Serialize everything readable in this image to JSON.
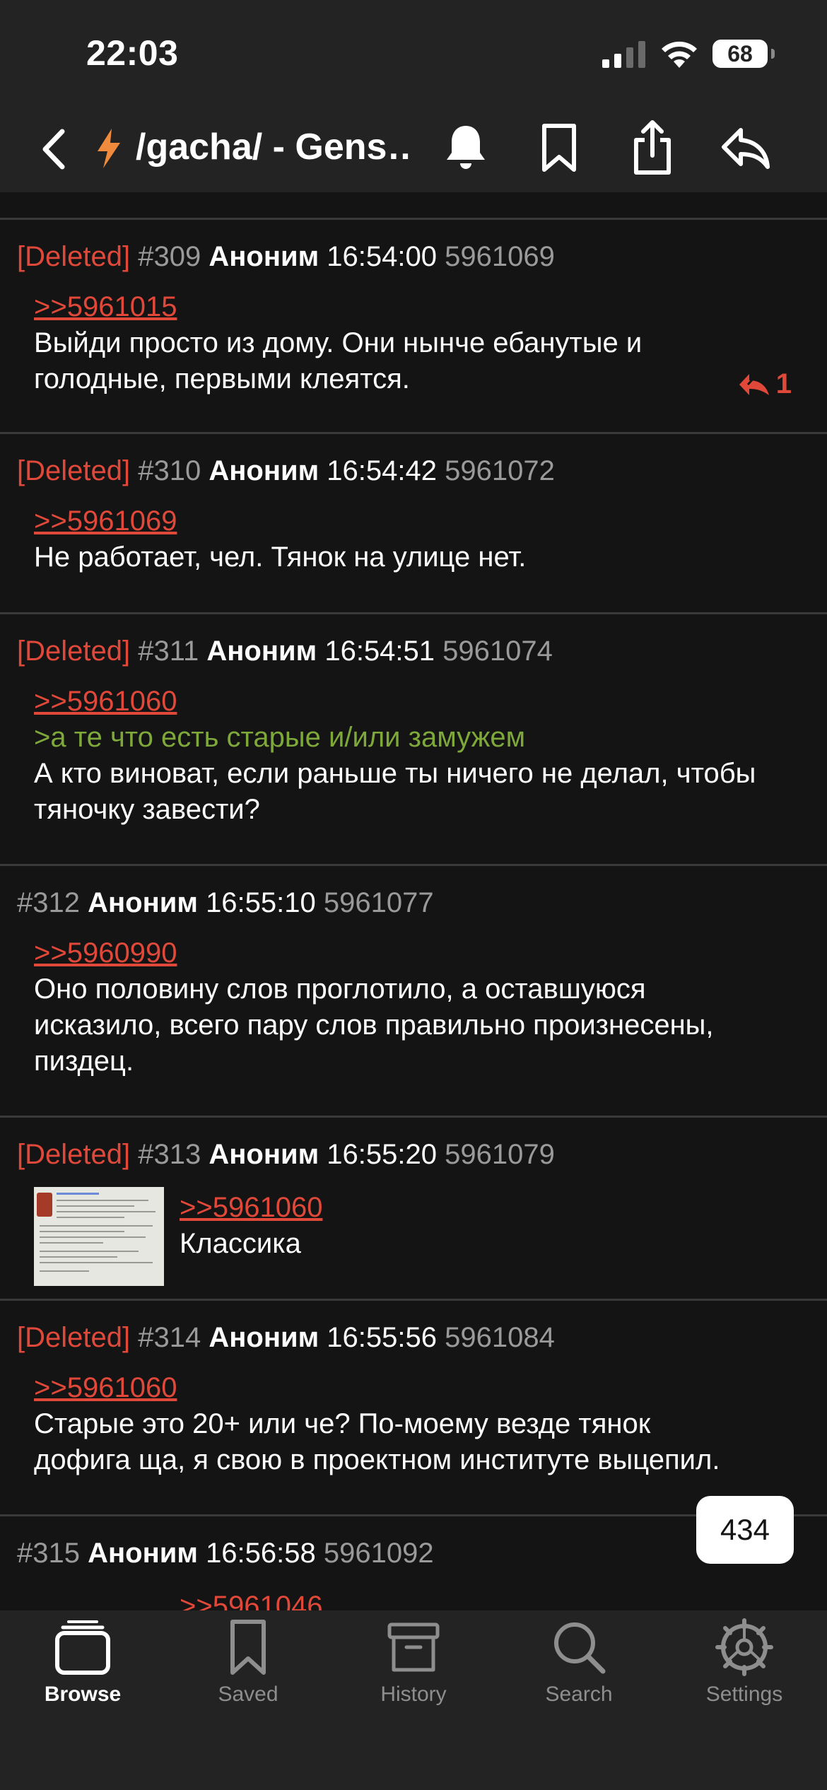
{
  "status": {
    "time": "22:03",
    "battery": "68"
  },
  "nav": {
    "title": "/gacha/ - Gens…"
  },
  "posts": [
    {
      "deleted": "[Deleted]",
      "num": "#309",
      "author": "Аноним",
      "time": "16:54:00",
      "pid": "5961069",
      "quote": ">>5961015",
      "lines": [
        "Выйди просто из дому. Они нынче ебанутые и",
        "голодные, первыми клеятся."
      ],
      "replies": "1"
    },
    {
      "deleted": "[Deleted]",
      "num": "#310",
      "author": "Аноним",
      "time": "16:54:42",
      "pid": "5961072",
      "quote": ">>5961069",
      "lines": [
        "Не работает, чел. Тянок на улице нет."
      ]
    },
    {
      "deleted": "[Deleted]",
      "num": "#311",
      "author": "Аноним",
      "time": "16:54:51",
      "pid": "5961074",
      "quote": ">>5961060",
      "green": ">а те что есть старые и/или замужем",
      "lines": [
        "А кто виноват, если раньше ты ничего не делал, чтобы",
        "тяночку завести?"
      ]
    },
    {
      "num": "#312",
      "author": "Аноним",
      "time": "16:55:10",
      "pid": "5961077",
      "quote": ">>5960990",
      "lines": [
        "Оно половину слов проглотило, а оставшуюся",
        "исказило, всего пару слов правильно произнесены,",
        "пиздец."
      ]
    },
    {
      "deleted": "[Deleted]",
      "num": "#313",
      "author": "Аноним",
      "time": "16:55:20",
      "pid": "5961079",
      "quote": ">>5961060",
      "lines": [
        "Классика"
      ]
    },
    {
      "deleted": "[Deleted]",
      "num": "#314",
      "author": "Аноним",
      "time": "16:55:56",
      "pid": "5961084",
      "quote": ">>5961060",
      "lines": [
        "Старые это 20+ или че? По-моему везде тянок",
        "дофига ща, я свою в проектном институте выцепил."
      ]
    },
    {
      "num": "#315",
      "author": "Аноним",
      "time": "16:56:58",
      "pid": "5961092",
      "quote": ">>5961046"
    }
  ],
  "counter": "434",
  "tabs": [
    {
      "label": "Browse",
      "icon": "browse-icon"
    },
    {
      "label": "Saved",
      "icon": "bookmark-icon"
    },
    {
      "label": "History",
      "icon": "archive-icon"
    },
    {
      "label": "Search",
      "icon": "search-icon"
    },
    {
      "label": "Settings",
      "icon": "gear-icon"
    }
  ],
  "colors": {
    "background": "#141414",
    "bar": "#232323",
    "accent_red": "#e0493a",
    "greentext": "#7ea83a",
    "muted": "#9a9a9a"
  }
}
